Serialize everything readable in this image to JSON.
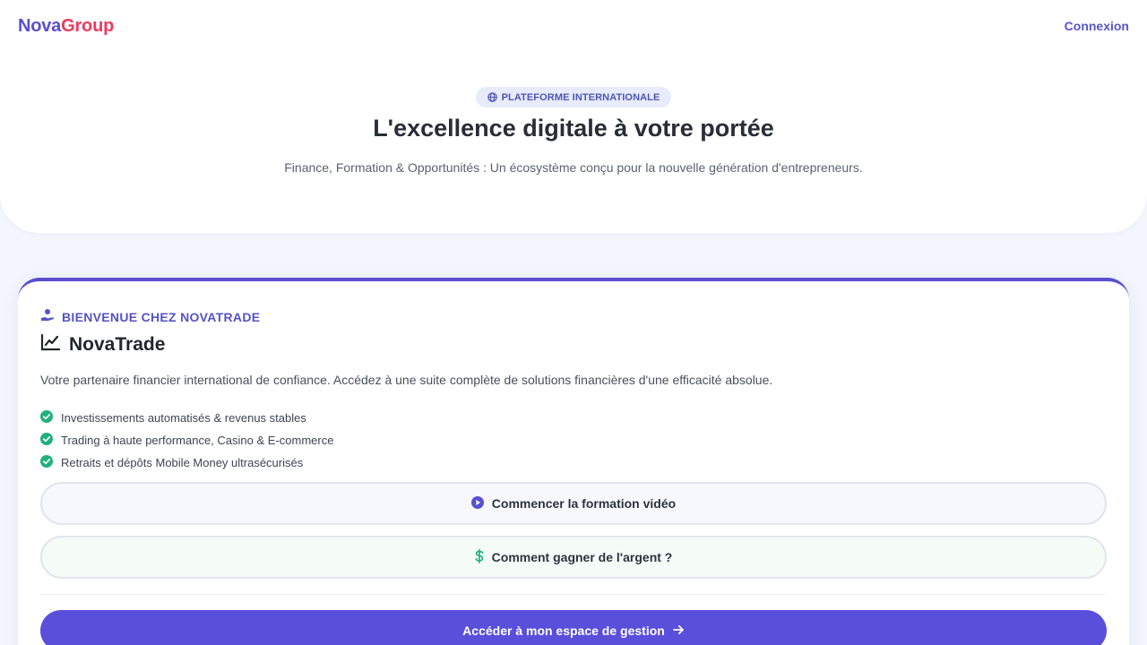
{
  "header": {
    "logo_part1": "Nova",
    "logo_part2": "Group",
    "login_label": "Connexion"
  },
  "hero": {
    "badge_icon": "globe-icon",
    "badge_label": "PLATEFORME INTERNATIONALE",
    "title": "L'excellence digitale à votre portée",
    "subtitle": "Finance, Formation & Opportunités : Un écosystème conçu pour la nouvelle génération d'entrepreneurs."
  },
  "card": {
    "welcome_icon": "hand-holding-user-icon",
    "welcome_label": "BIENVENUE CHEZ NOVATRADE",
    "product_icon": "chart-line-icon",
    "product_name": "NovaTrade",
    "description": "Votre partenaire financier international de confiance. Accédez à une suite complète de solutions financières d'une efficacité absolue.",
    "features": [
      "Investissements automatisés & revenus stables",
      "Trading à haute performance, Casino & E-commerce",
      "Retraits et dépôts Mobile Money ultrasécurisés"
    ],
    "video_button_label": "Commencer la formation vidéo",
    "money_button_label": "Comment gagner de l'argent ?",
    "primary_button_label": "Accéder à mon espace de gestion"
  },
  "colors": {
    "accent": "#5a4fcf",
    "brand_red": "#ef3a5d",
    "success": "#22b07d",
    "background": "#f3f6fd"
  }
}
